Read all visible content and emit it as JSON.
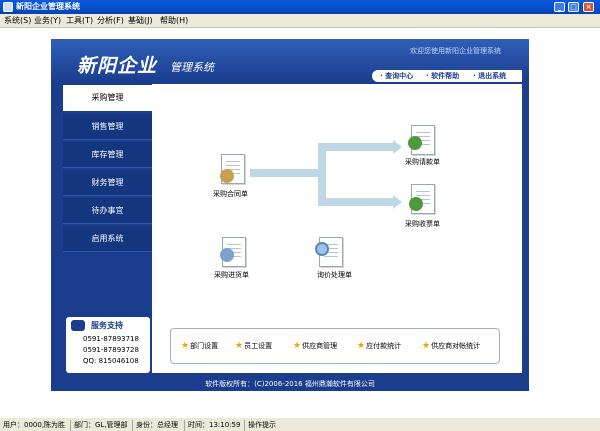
{
  "window": {
    "title": "新阳企业管理系统"
  },
  "menubar": {
    "items": [
      "系统(S)",
      "业务(Y)",
      "工具(T)",
      "分析(F)",
      "基础(J)",
      "帮助(H)"
    ]
  },
  "header": {
    "logo": "新阳企业",
    "logo_sub": "管理系统",
    "welcome": "欢迎您使用新阳企业管理系统",
    "links": [
      "· 查询中心",
      "· 软件帮助",
      "· 退出系统"
    ]
  },
  "nav": {
    "items": [
      "采购管理",
      "销售管理",
      "库存管理",
      "财务管理",
      "待办事宜",
      "启用系统"
    ]
  },
  "support": {
    "title": "服务支持",
    "lines": [
      "0591-87893718",
      "0591-87893728",
      "QQ: 815046108"
    ]
  },
  "workflow": {
    "icons": [
      "采购合同单",
      "采购请款单",
      "采购收票单",
      "采购进货单",
      "询价处理单"
    ]
  },
  "shortcuts": [
    "部门设置",
    "员工设置",
    "供应商管理",
    "应付款统计",
    "供应商对帐统计"
  ],
  "footer": "软件版权所有：(C)2006-2016 福州鼎瀚软件有限公司",
  "status": [
    "用户：0000,陈为胜",
    "部门：GL,管理部",
    "身份：总经理",
    "时间：13:10:59",
    "操作提示"
  ]
}
